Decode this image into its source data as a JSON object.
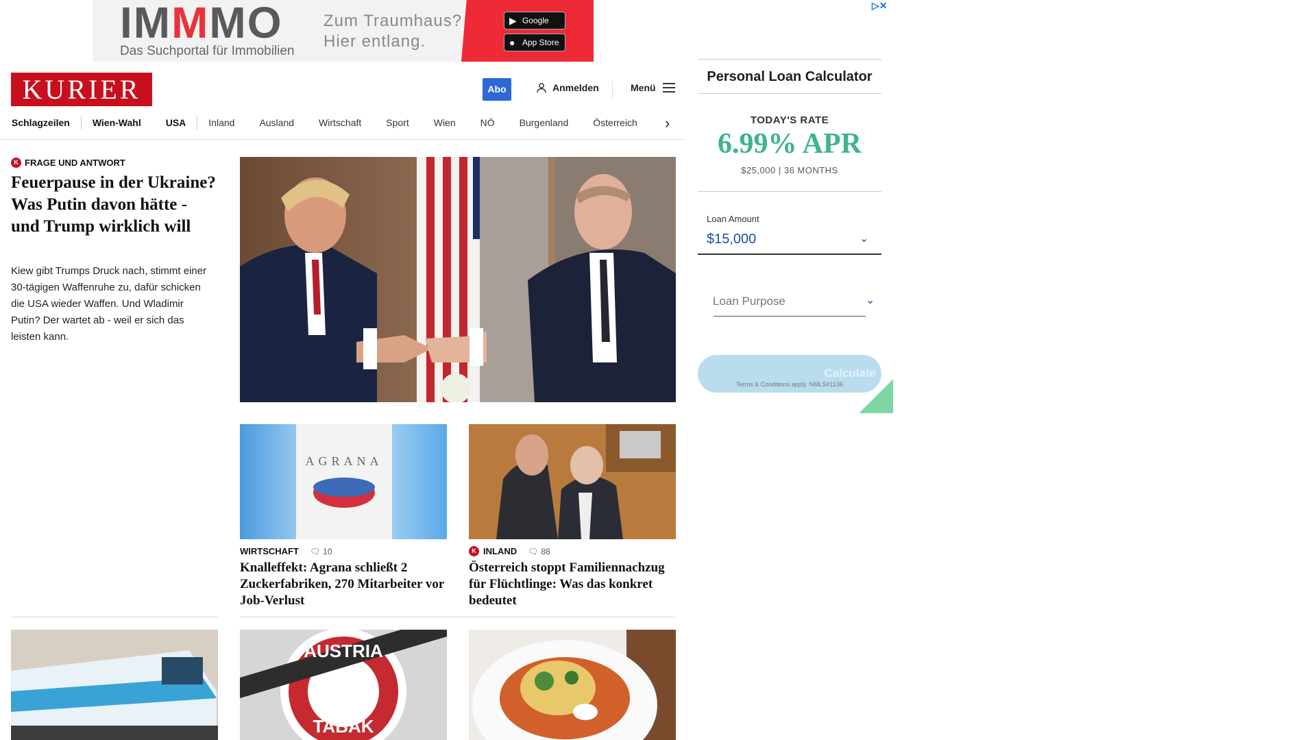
{
  "top_ad": {
    "brand_part1": "IM",
    "brand_red": "M",
    "brand_part2": "MO",
    "subtitle": "Das Suchportal für Immobilien",
    "slogan_line1": "Zum Traumhaus?",
    "slogan_line2": "Hier entlang.",
    "google_play": "Google Play",
    "app_store": "App Store"
  },
  "header": {
    "logo": "KURIER",
    "abo": "Abo",
    "login": "Anmelden",
    "menu": "Menü"
  },
  "nav": {
    "items": [
      "Schlagzeilen",
      "Wien-Wahl",
      "USA",
      "Inland",
      "Ausland",
      "Wirtschaft",
      "Sport",
      "Wien",
      "NÖ",
      "Burgenland",
      "Österreich"
    ]
  },
  "lead": {
    "kicker": "Frage und Antwort",
    "title": "Feuerpause in der Ukraine? Was Putin davon hätte - und Trump wirklich will",
    "text": "Kiew gibt Trumps Druck nach, stimmt einer 30-tägigen Waffenruhe zu, dafür schicken die USA wieder Waffen. Und Wladimir Putin? Der wartet ab - weil er sich das leisten kann."
  },
  "cards": [
    {
      "section": "Wirtschaft",
      "comments": "10",
      "title": "Knalleffekt: Agrana schließt 2 Zuckerfabriken, 270 Mitarbeiter vor Job-Verlust",
      "image_text": "AGRANA"
    },
    {
      "section": "Inland",
      "comments": "88",
      "title": "Österreich stoppt Familiennachzug für Flüchtlinge: Was das konkret bedeutet"
    }
  ],
  "bottom_cards": [
    {
      "image_label": "train"
    },
    {
      "image_text_top": "AUSTRIA",
      "image_text_bottom": "TABAK"
    },
    {
      "image_label": "food"
    }
  ],
  "side_ad": {
    "title": "Personal Loan Calculator",
    "rate_label": "TODAY'S RATE",
    "rate": "6.99% APR",
    "rate_sub": "$25,000 | 36 MONTHS",
    "loan_amount_label": "Loan Amount",
    "loan_amount_value": "$15,000",
    "loan_purpose_placeholder": "Loan Purpose",
    "calculate": "Calculate",
    "terms": "Terms & Conditions apply. NMLS#1136"
  },
  "colors": {
    "kurier_red": "#c80f1e",
    "abo_blue": "#2c68d6",
    "rate_green": "#3cb589"
  }
}
